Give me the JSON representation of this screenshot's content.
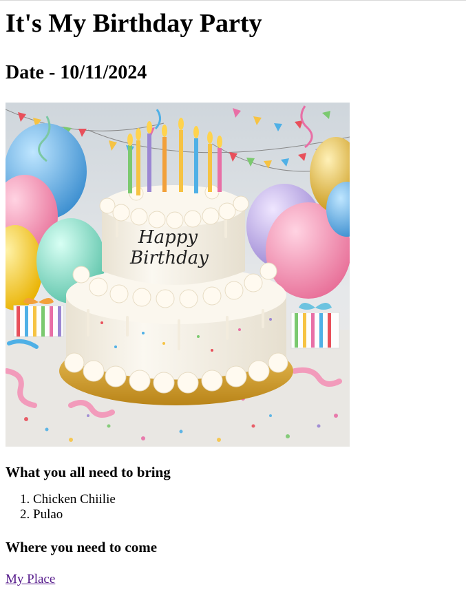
{
  "page": {
    "title": "It's My Birthday Party",
    "date_heading": "Date - 10/11/2024"
  },
  "image": {
    "icon": "birthday-cake-image",
    "cake_text_line1": "Happy",
    "cake_text_line2": "Birthday",
    "colors": {
      "cream": "#f6f1e4",
      "gold_board": "#d9a93a",
      "balloon_blue": "#5aa9e0",
      "balloon_pink": "#f28fb0",
      "balloon_yellow": "#f4c430",
      "balloon_mint": "#8ed8c4",
      "balloon_lilac": "#b9a6e0"
    }
  },
  "bring": {
    "heading": "What you all need to bring",
    "items": [
      "Chicken Chiilie",
      "Pulao"
    ]
  },
  "where": {
    "heading": "Where you need to come",
    "link_text": "My Place"
  }
}
